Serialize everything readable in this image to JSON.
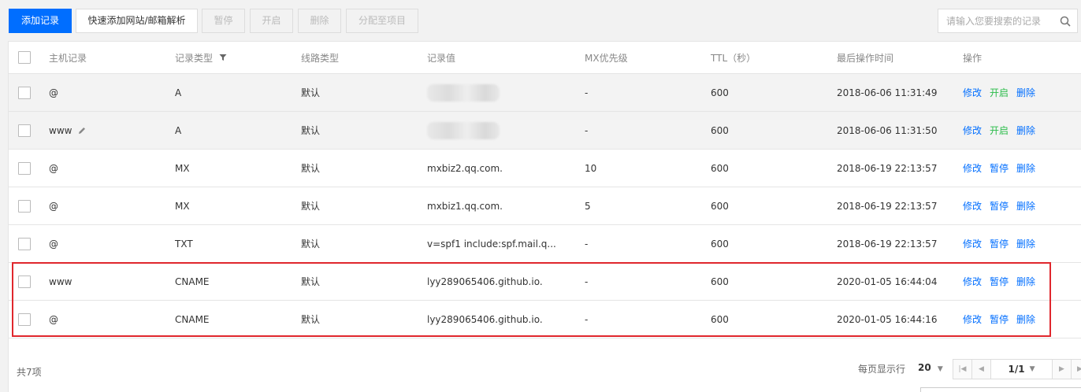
{
  "toolbar": {
    "add_record": "添加记录",
    "quick_add": "快速添加网站/邮箱解析",
    "pause": "暂停",
    "enable": "开启",
    "delete": "删除",
    "assign_project": "分配至项目"
  },
  "search": {
    "placeholder": "请输入您要搜索的记录"
  },
  "table": {
    "headers": {
      "host": "主机记录",
      "type": "记录类型",
      "line": "线路类型",
      "value": "记录值",
      "mx": "MX优先级",
      "ttl": "TTL（秒）",
      "time": "最后操作时间",
      "ops": "操作"
    },
    "rows": [
      {
        "host": "@",
        "type": "A",
        "line": "默认",
        "value": "",
        "mx": "-",
        "ttl": "600",
        "time": "2018-06-06 11:31:49",
        "op1": "修改",
        "op2": "开启",
        "op3": "删除"
      },
      {
        "host": "www",
        "type": "A",
        "line": "默认",
        "value": "",
        "mx": "-",
        "ttl": "600",
        "time": "2018-06-06 11:31:50",
        "op1": "修改",
        "op2": "开启",
        "op3": "删除"
      },
      {
        "host": "@",
        "type": "MX",
        "line": "默认",
        "value": "mxbiz2.qq.com.",
        "mx": "10",
        "ttl": "600",
        "time": "2018-06-19 22:13:57",
        "op1": "修改",
        "op2": "暂停",
        "op3": "删除"
      },
      {
        "host": "@",
        "type": "MX",
        "line": "默认",
        "value": "mxbiz1.qq.com.",
        "mx": "5",
        "ttl": "600",
        "time": "2018-06-19 22:13:57",
        "op1": "修改",
        "op2": "暂停",
        "op3": "删除"
      },
      {
        "host": "@",
        "type": "TXT",
        "line": "默认",
        "value": "v=spf1 include:spf.mail.q...",
        "mx": "-",
        "ttl": "600",
        "time": "2018-06-19 22:13:57",
        "op1": "修改",
        "op2": "暂停",
        "op3": "删除"
      },
      {
        "host": "www",
        "type": "CNAME",
        "line": "默认",
        "value": "lyy289065406.github.io.",
        "mx": "-",
        "ttl": "600",
        "time": "2020-01-05 16:44:04",
        "op1": "修改",
        "op2": "暂停",
        "op3": "删除"
      },
      {
        "host": "@",
        "type": "CNAME",
        "line": "默认",
        "value": "lyy289065406.github.io.",
        "mx": "-",
        "ttl": "600",
        "time": "2020-01-05 16:44:16",
        "op1": "修改",
        "op2": "暂停",
        "op3": "删除"
      }
    ]
  },
  "footer": {
    "total": "共7项",
    "per_page_label": "每页显示行",
    "per_page_value": "20",
    "page_indicator": "1/1"
  },
  "colors": {
    "primary": "#006eff",
    "enabled_op": "#2bbc4a",
    "highlight": "#e0272d"
  }
}
